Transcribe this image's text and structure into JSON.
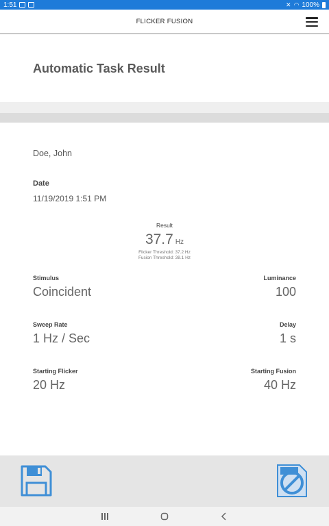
{
  "status_bar": {
    "time": "1:51",
    "battery": "100%"
  },
  "app_bar": {
    "title": "FLICKER FUSION",
    "menu_icon": "hamburger-menu-icon"
  },
  "page": {
    "title": "Automatic Task Result"
  },
  "patient": {
    "name": "Doe, John"
  },
  "date": {
    "label": "Date",
    "value": "11/19/2019 1:51 PM"
  },
  "result": {
    "label": "Result",
    "value": "37.7",
    "unit": "Hz",
    "flicker_threshold": "Flicker Threshold: 37.2 Hz",
    "fusion_threshold": "Fusion Threshold: 38.1 Hz"
  },
  "fields": {
    "stimulus": {
      "label": "Stimulus",
      "value": "Coincident"
    },
    "luminance": {
      "label": "Luminance",
      "value": "100"
    },
    "sweep_rate": {
      "label": "Sweep Rate",
      "value": "1 Hz / Sec"
    },
    "delay": {
      "label": "Delay",
      "value": "1 s"
    },
    "starting_flicker": {
      "label": "Starting Flicker",
      "value": "20 Hz"
    },
    "starting_fusion": {
      "label": "Starting Fusion",
      "value": "40 Hz"
    }
  },
  "actions": {
    "save_icon": "floppy-disk-icon",
    "cancel_icon": "document-no-icon"
  },
  "nav": {
    "recents_icon": "recents-icon",
    "home_icon": "home-icon",
    "back_icon": "back-icon"
  },
  "colors": {
    "status_bar": "#1e7bd9",
    "accent_blue": "#3f8fd6",
    "bottom_bar": "#e5e5e5"
  }
}
